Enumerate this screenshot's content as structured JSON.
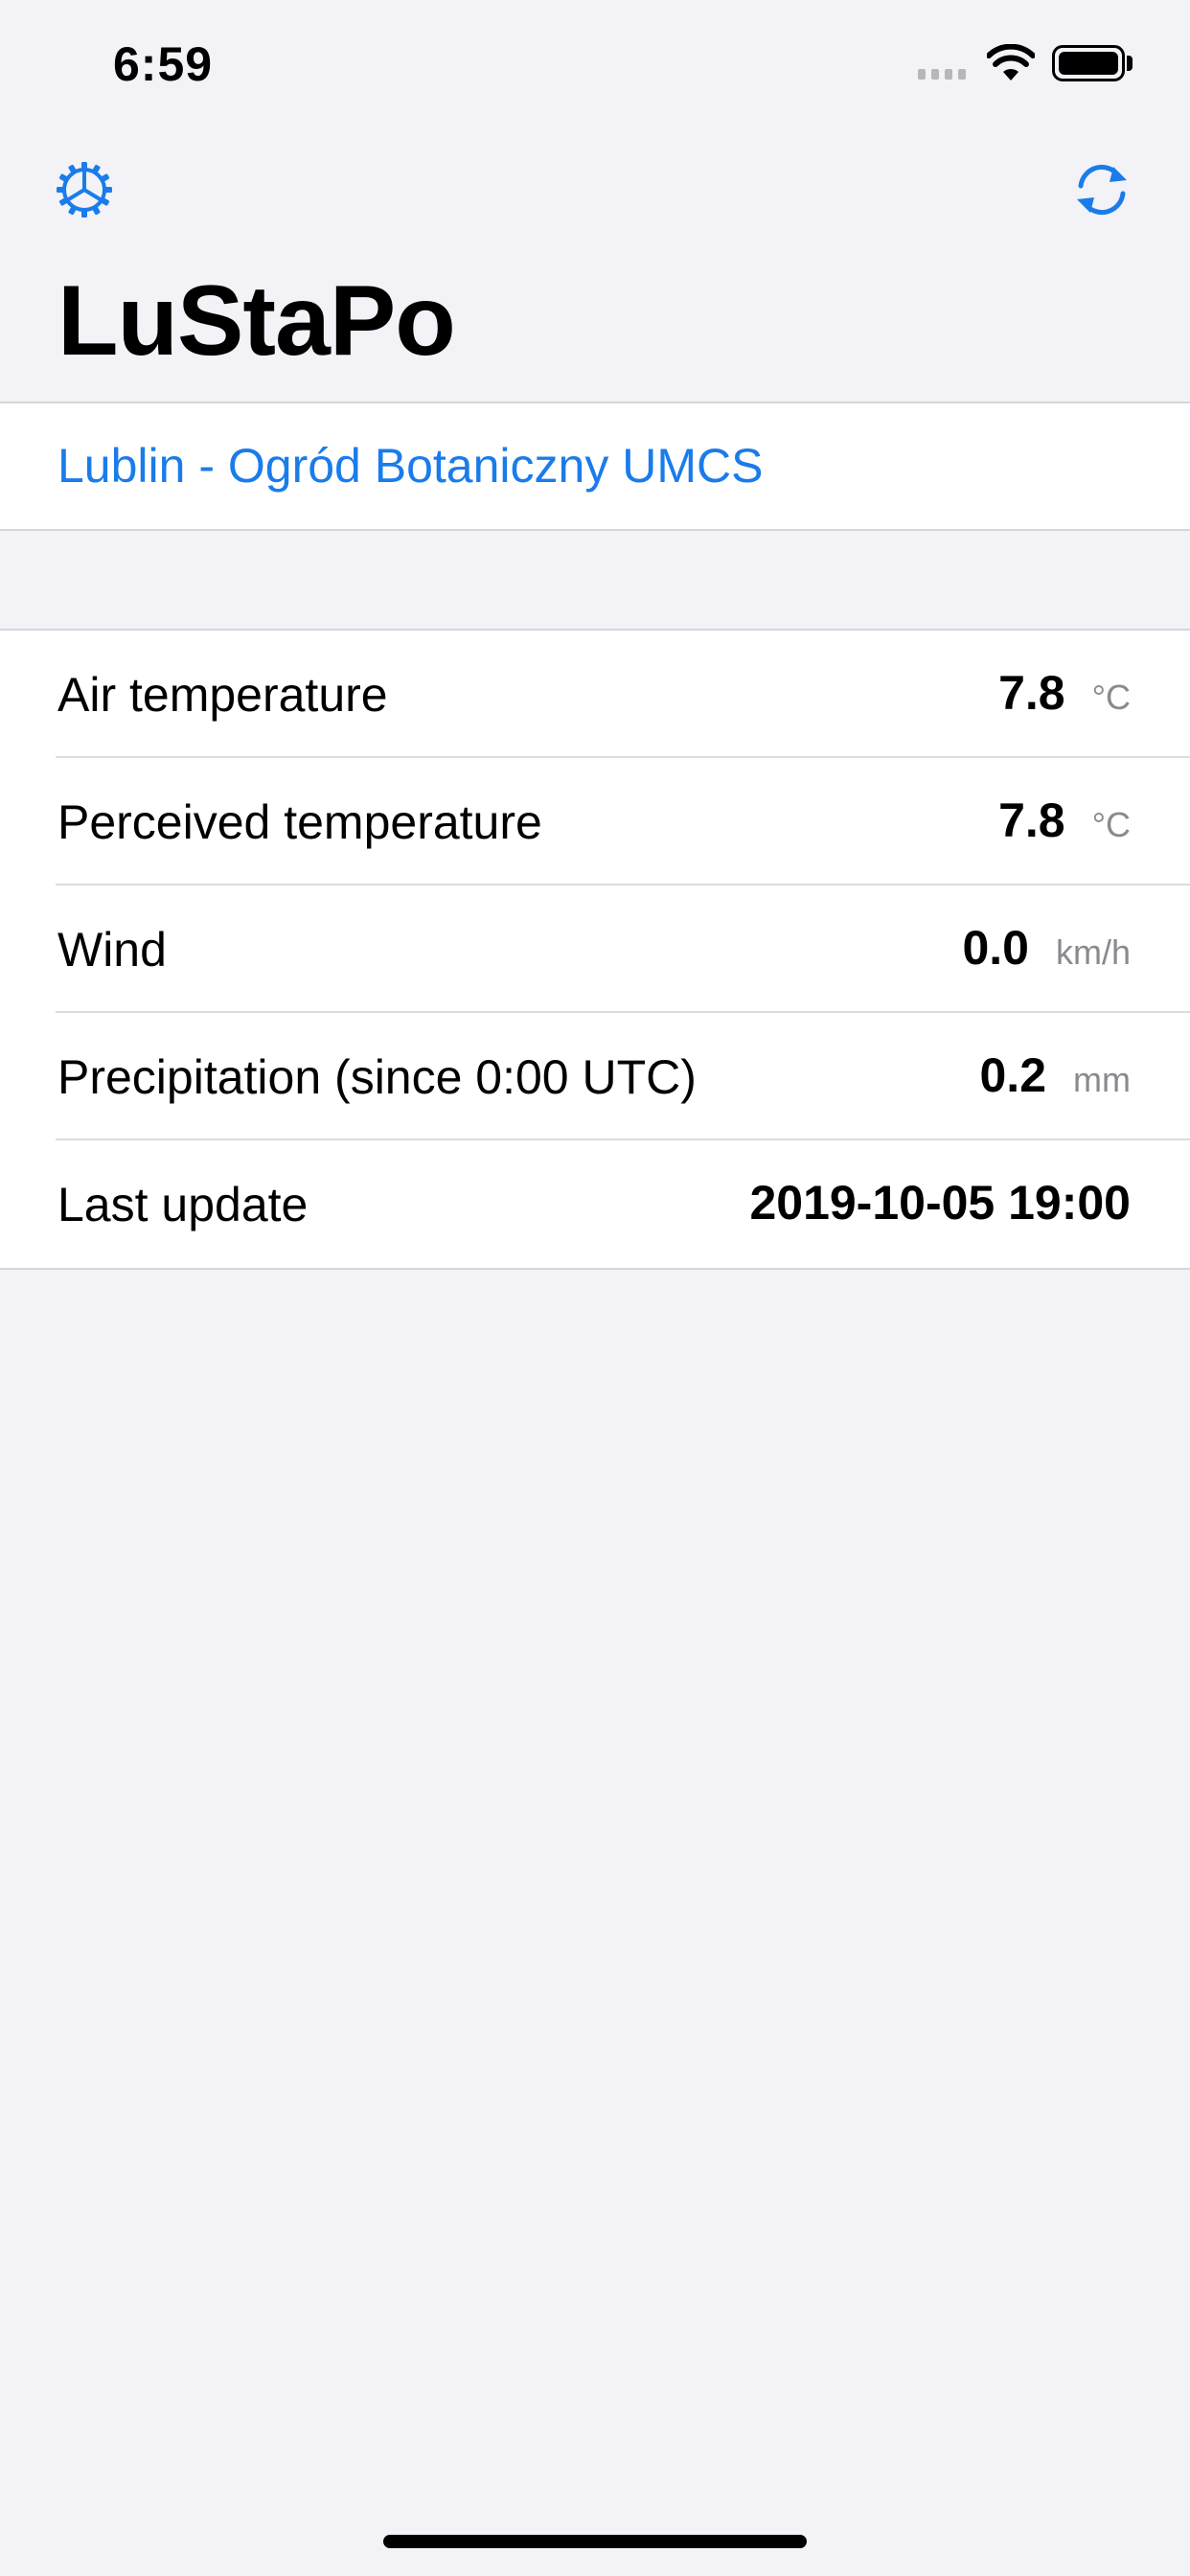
{
  "status_bar": {
    "time": "6:59"
  },
  "nav": {
    "title": "LuStaPo",
    "settings_icon": "gear-icon",
    "refresh_icon": "refresh-icon",
    "accent_color": "#1a7cea"
  },
  "station": {
    "name": "Lublin - Ogród Botaniczny UMCS"
  },
  "readings": [
    {
      "label": "Air temperature",
      "value": "7.8",
      "unit": "°C"
    },
    {
      "label": "Perceived temperature",
      "value": "7.8",
      "unit": "°C"
    },
    {
      "label": "Wind",
      "value": "0.0",
      "unit": "km/h"
    },
    {
      "label": "Precipitation (since 0:00 UTC)",
      "value": "0.2",
      "unit": "mm"
    }
  ],
  "last_update": {
    "label": "Last update",
    "value": "2019-10-05 19:00"
  }
}
